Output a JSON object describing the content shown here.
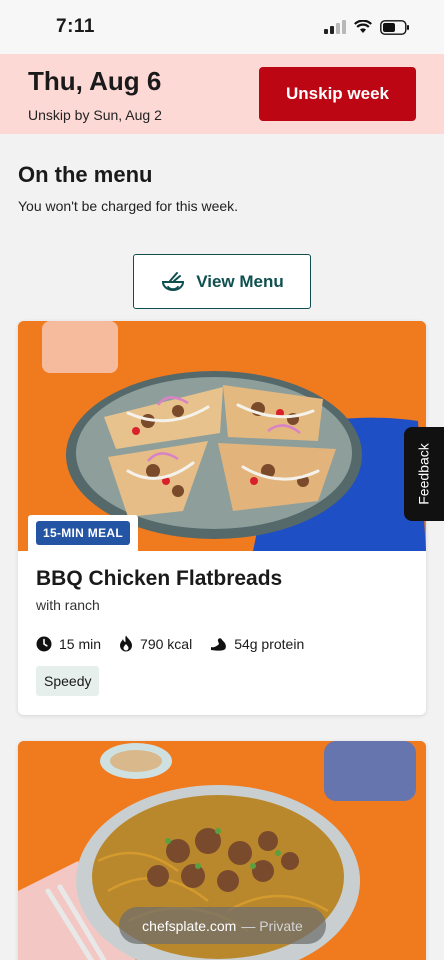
{
  "status_bar": {
    "time": "7:11"
  },
  "banner": {
    "date": "Thu, Aug 6",
    "subtitle": "Unskip by Sun, Aug 2",
    "button_label": "Unskip week",
    "button_color": "#bd0613",
    "background_color": "#fdd9d6"
  },
  "menu_section": {
    "title": "On the menu",
    "subtitle": "You won't be charged for this week.",
    "view_menu_label": "View Menu"
  },
  "meals": [
    {
      "badge": "15-MIN MEAL",
      "title": "BBQ Chicken Flatbreads",
      "subtitle": "with ranch",
      "time": "15 min",
      "calories": "790 kcal",
      "protein": "54g protein",
      "tag": "Speedy"
    }
  ],
  "feedback_label": "Feedback",
  "browser": {
    "domain": "chefsplate.com",
    "mode": "— Private"
  },
  "colors": {
    "accent": "#0f4f4f",
    "badge": "#2454a4",
    "tag_bg": "#e6efeb",
    "card_image_bg": "#f07a1e"
  }
}
